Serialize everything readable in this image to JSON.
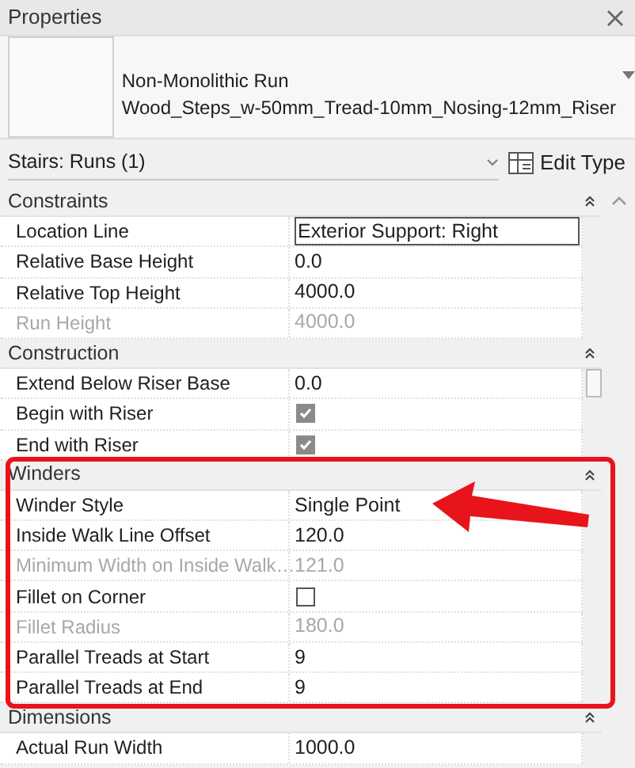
{
  "panel": {
    "title": "Properties"
  },
  "type_selector": {
    "family": "Non-Monolithic Run",
    "type": "Wood_Steps_w-50mm_Tread-10mm_Nosing-12mm_Riser"
  },
  "instance_filter": {
    "label": "Stairs: Runs (1)",
    "edit_type": "Edit Type"
  },
  "groups": [
    {
      "name": "Constraints",
      "expanded": true,
      "rows": [
        {
          "label": "Location Line",
          "value": "Exterior Support: Right",
          "kind": "field",
          "disabled": false
        },
        {
          "label": "Relative Base Height",
          "value": "0.0",
          "kind": "text",
          "disabled": false
        },
        {
          "label": "Relative Top Height",
          "value": "4000.0",
          "kind": "text",
          "disabled": false
        },
        {
          "label": "Run Height",
          "value": "4000.0",
          "kind": "text",
          "disabled": true
        }
      ]
    },
    {
      "name": "Construction",
      "expanded": true,
      "rows": [
        {
          "label": "Extend Below Riser Base",
          "value": "0.0",
          "kind": "text",
          "disabled": false
        },
        {
          "label": "Begin with Riser",
          "checked": true,
          "kind": "checkbox",
          "disabled": false
        },
        {
          "label": "End with Riser",
          "checked": true,
          "kind": "checkbox",
          "disabled": false
        }
      ]
    },
    {
      "name": "Winders",
      "expanded": true,
      "rows": [
        {
          "label": "Winder Style",
          "value": "Single Point",
          "kind": "text",
          "disabled": false
        },
        {
          "label": "Inside Walk Line Offset",
          "value": "120.0",
          "kind": "text",
          "disabled": false
        },
        {
          "label": "Minimum Width on Inside Walk…",
          "value": "121.0",
          "kind": "text",
          "disabled": true
        },
        {
          "label": "Fillet on Corner",
          "checked": false,
          "kind": "checkbox",
          "disabled": false
        },
        {
          "label": "Fillet Radius",
          "value": "180.0",
          "kind": "text",
          "disabled": true
        },
        {
          "label": "Parallel Treads at Start",
          "value": "9",
          "kind": "text",
          "disabled": false
        },
        {
          "label": "Parallel Treads at End",
          "value": "9",
          "kind": "text",
          "disabled": false
        }
      ]
    },
    {
      "name": "Dimensions",
      "expanded": true,
      "rows": [
        {
          "label": "Actual Run Width",
          "value": "1000.0",
          "kind": "text",
          "disabled": false
        }
      ]
    }
  ]
}
